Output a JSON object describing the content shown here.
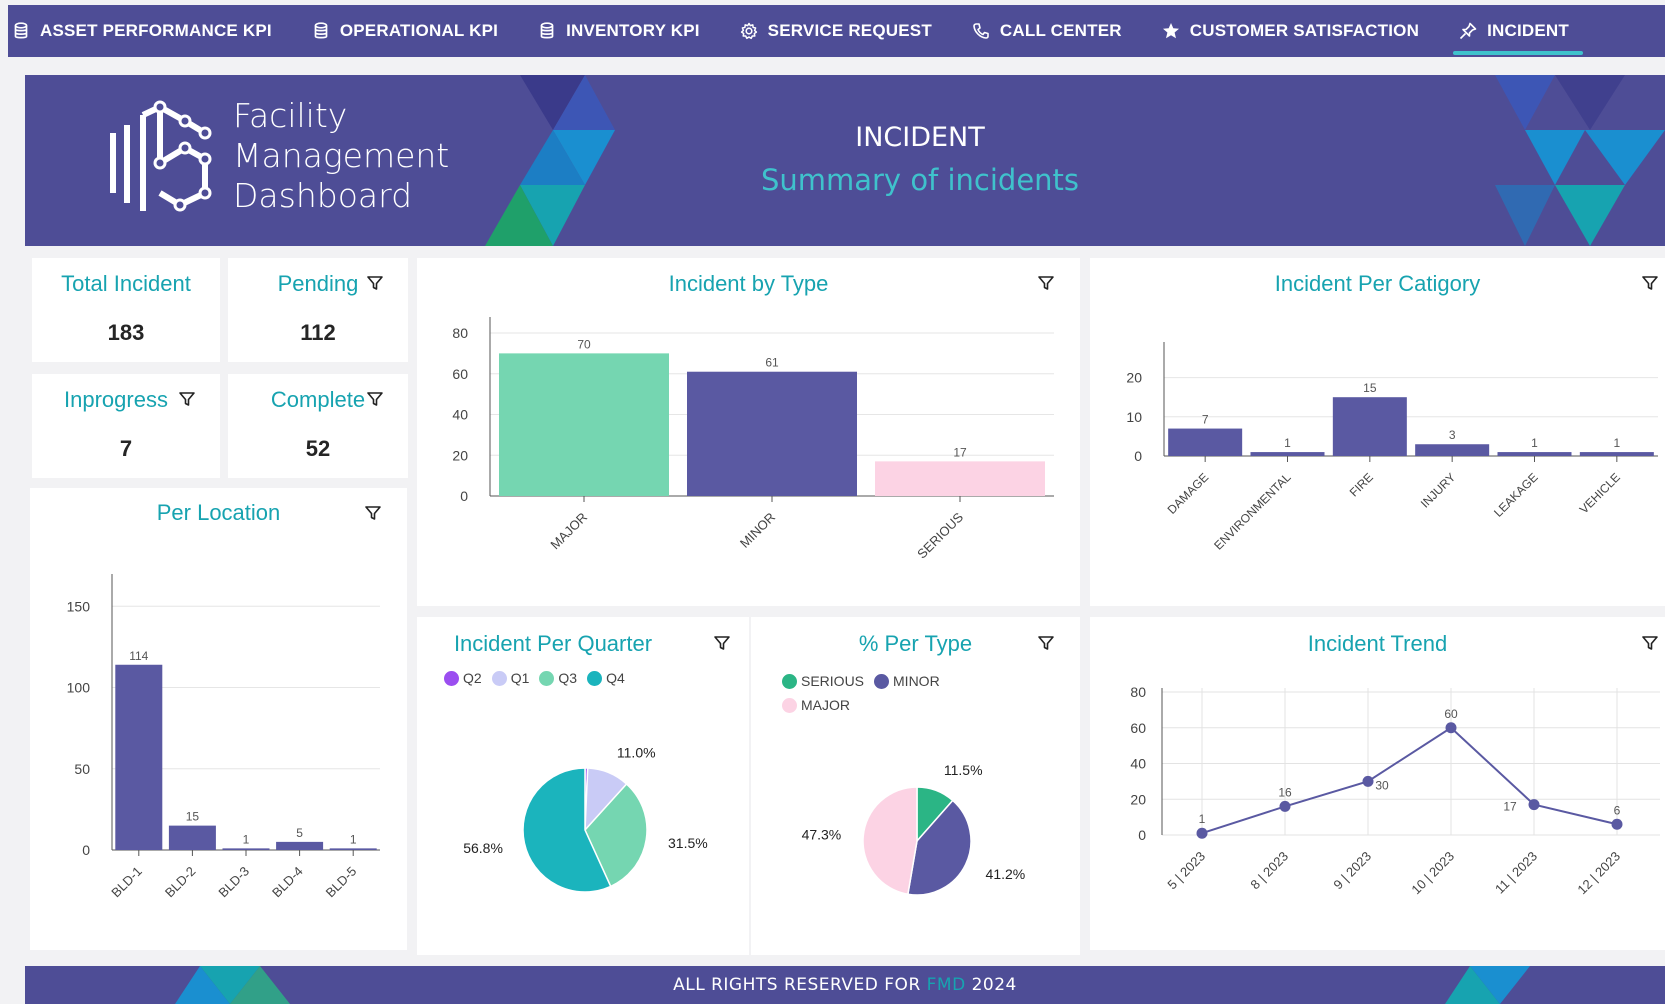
{
  "nav": {
    "items": [
      {
        "label": "ASSET PERFORMANCE KPI",
        "icon": "database-icon",
        "active": false
      },
      {
        "label": "OPERATIONAL KPI",
        "icon": "database-icon",
        "active": false
      },
      {
        "label": "INVENTORY KPI",
        "icon": "database-icon",
        "active": false
      },
      {
        "label": "SERVICE REQUEST",
        "icon": "gear-icon",
        "active": false
      },
      {
        "label": "CALL CENTER",
        "icon": "phone-icon",
        "active": false
      },
      {
        "label": "CUSTOMER SATISFACTION",
        "icon": "star-icon",
        "active": false
      },
      {
        "label": "INCIDENT",
        "icon": "pin-icon",
        "active": true
      }
    ]
  },
  "banner": {
    "brand_line1": "Facility",
    "brand_line2": "Management",
    "brand_line3": "Dashboard",
    "title": "INCIDENT",
    "subtitle": "Summary of incidents"
  },
  "kpis": {
    "total": {
      "label": "Total Incident",
      "value": "183"
    },
    "pending": {
      "label": "Pending",
      "value": "112"
    },
    "inprogress": {
      "label": "Inprogress",
      "value": "7"
    },
    "complete": {
      "label": "Complete",
      "value": "52"
    }
  },
  "cards": {
    "per_location": "Per Location",
    "by_type": "Incident by Type",
    "per_category": "Incident Per Catigory",
    "per_quarter": "Incident Per Quarter",
    "pct_type": "% Per Type",
    "trend": "Incident Trend"
  },
  "colors": {
    "primary": "#4e4d96",
    "bar": "#5a59a2",
    "teal": "#17a3b0",
    "mint": "#75d6b1",
    "pink": "#fcd3e4",
    "green": "#2bb585"
  },
  "chart_data": [
    {
      "id": "per_location",
      "type": "bar",
      "title": "Per Location",
      "categories": [
        "BLD-1",
        "BLD-2",
        "BLD-3",
        "BLD-4",
        "BLD-5"
      ],
      "values": [
        114,
        15,
        1,
        5,
        1
      ],
      "ylim": [
        0,
        160
      ],
      "yticks": [
        0,
        50,
        100,
        150
      ]
    },
    {
      "id": "by_type",
      "type": "bar",
      "title": "Incident by Type",
      "categories": [
        "MAJOR",
        "MINOR",
        "SERIOUS"
      ],
      "values": [
        70,
        61,
        17
      ],
      "colors": [
        "#75d6b1",
        "#5a59a2",
        "#fcd3e4"
      ],
      "ylim": [
        0,
        80
      ],
      "yticks": [
        0,
        20,
        40,
        60,
        80
      ]
    },
    {
      "id": "per_category",
      "type": "bar",
      "title": "Incident Per Catigory",
      "categories": [
        "DAMAGE",
        "ENVIRONMENTAL",
        "FIRE",
        "INJURY",
        "LEAKAGE",
        "VEHICLE"
      ],
      "values": [
        7,
        1,
        15,
        3,
        1,
        1
      ],
      "ylim": [
        0,
        25
      ],
      "yticks": [
        0,
        10,
        20
      ]
    },
    {
      "id": "per_quarter",
      "type": "pie",
      "title": "Incident Per Quarter",
      "legend": [
        {
          "name": "Q2",
          "color": "#9b4ef0"
        },
        {
          "name": "Q1",
          "color": "#c9cbf6"
        },
        {
          "name": "Q3",
          "color": "#75d6b1"
        },
        {
          "name": "Q4",
          "color": "#1bb4bd"
        }
      ],
      "slices": [
        {
          "name": "Q2",
          "value": 0.7,
          "color": "#9b4ef0",
          "label": ""
        },
        {
          "name": "Q1",
          "value": 11.0,
          "color": "#c9cbf6",
          "label": "11.0%"
        },
        {
          "name": "Q3",
          "value": 31.5,
          "color": "#75d6b1",
          "label": "31.5%"
        },
        {
          "name": "Q4",
          "value": 56.8,
          "color": "#1bb4bd",
          "label": "56.8%"
        }
      ]
    },
    {
      "id": "pct_type",
      "type": "pie",
      "title": "% Per Type",
      "legend": [
        {
          "name": "SERIOUS",
          "color": "#2bb585"
        },
        {
          "name": "MINOR",
          "color": "#5a59a2"
        },
        {
          "name": "MAJOR",
          "color": "#fcd3e4"
        }
      ],
      "slices": [
        {
          "name": "SERIOUS",
          "value": 11.5,
          "color": "#2bb585",
          "label": "11.5%"
        },
        {
          "name": "MINOR",
          "value": 41.2,
          "color": "#5a59a2",
          "label": "41.2%"
        },
        {
          "name": "MAJOR",
          "value": 47.3,
          "color": "#fcd3e4",
          "label": "47.3%"
        }
      ]
    },
    {
      "id": "trend",
      "type": "line",
      "title": "Incident Trend",
      "categories": [
        "5 | 2023",
        "8 | 2023",
        "9 | 2023",
        "10 | 2023",
        "11 | 2023",
        "12 | 2023"
      ],
      "values": [
        1,
        16,
        30,
        60,
        17,
        6
      ],
      "ylim": [
        0,
        80
      ],
      "yticks": [
        0,
        20,
        40,
        60,
        80
      ]
    }
  ],
  "footer": {
    "prefix": "ALL RIGHTS RESERVED FOR",
    "brand": "FMD",
    "year": "2024"
  }
}
